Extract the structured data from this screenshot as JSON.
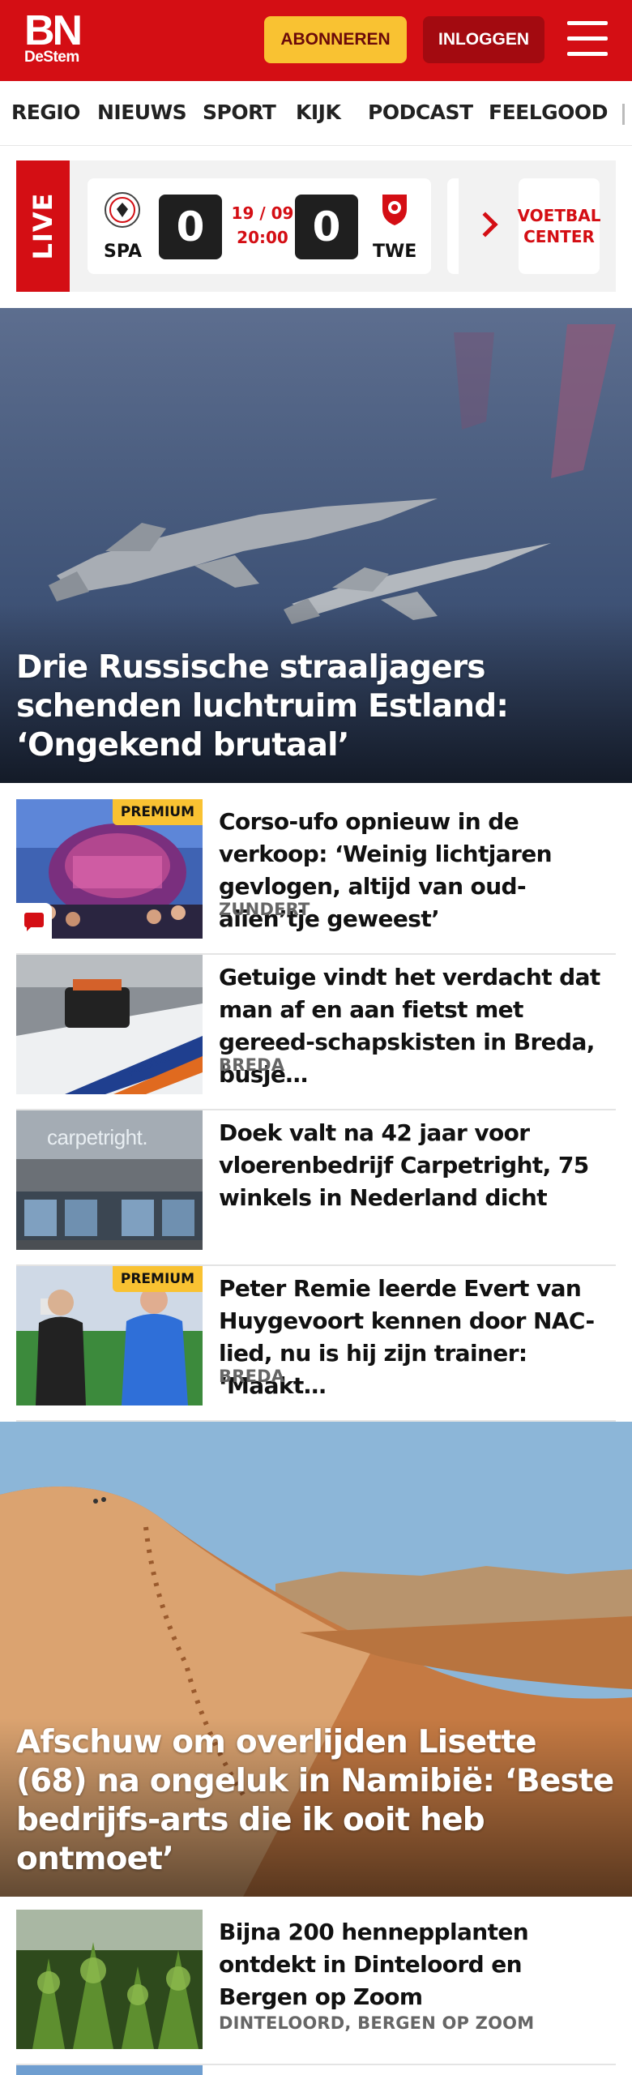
{
  "header": {
    "logo_main": "BN",
    "logo_sub": "DeStem",
    "subscribe_label": "ABONNEREN",
    "login_label": "INLOGGEN",
    "brand_color": "#d40e14",
    "icons": {
      "menu": "hamburger-menu-icon"
    }
  },
  "nav": {
    "items": [
      "REGIO",
      "NIEUWS",
      "SPORT",
      "KIJK",
      "PODCAST",
      "FEELGOOD"
    ]
  },
  "live": {
    "tag": "LIVE",
    "match": {
      "home_code": "SPA",
      "away_code": "TWE",
      "home_score": "0",
      "away_score": "0",
      "date": "19 / 09",
      "time": "20:00"
    },
    "center_line1": "VOETBAL",
    "center_line2": "CENTER"
  },
  "hero1": {
    "title": "Drie Russische straaljagers schenden luchtruim Estland: ‘Ongekend brutaal’"
  },
  "articles": [
    {
      "title": "Corso-ufo opnieuw in de verkoop: ‘Weinig lichtjaren gevlogen, altijd van oud-alien’tje geweest’",
      "location": "ZUNDERT",
      "badge": "PREMIUM"
    },
    {
      "title": "Getuige vindt het verdacht dat man af en aan fietst met gereed-schapskisten in Breda, busje…",
      "location": "BREDA"
    },
    {
      "title": "Doek valt na 42 jaar voor vloerenbedrijf Carpetright, 75 winkels in Nederland dicht",
      "thumb_text": "carpetright."
    },
    {
      "title": "Peter Remie leerde Evert van Huygevoort kennen door NAC-lied, nu is hij zijn trainer: ‘Maakt…",
      "location": "BREDA",
      "badge": "PREMIUM"
    }
  ],
  "hero2": {
    "title": "Afschuw om overlijden Lisette (68) na ongeluk in Namibië: ‘Beste bedrijfs-arts die ik ooit heb ontmoet’"
  },
  "articles2": [
    {
      "title": "Bijna 200 hennepplanten ontdekt in Dinteloord en Bergen op Zoom",
      "location": "DINTELOORD, BERGEN OP ZOOM"
    }
  ]
}
